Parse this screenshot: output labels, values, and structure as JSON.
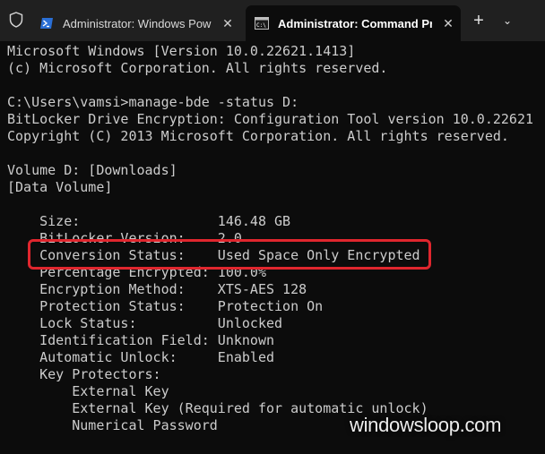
{
  "tabs": [
    {
      "title": "Administrator: Windows Power",
      "icon": "powershell-icon",
      "close": "✕",
      "active": false
    },
    {
      "title": "Administrator: Command Pro",
      "icon": "command-prompt-icon",
      "close": "✕",
      "active": true
    }
  ],
  "tabbar": {
    "new_tab": "+",
    "dropdown": "⌄",
    "shield_icon": "shield-icon"
  },
  "terminal": {
    "lines": [
      "Microsoft Windows [Version 10.0.22621.1413]",
      "(c) Microsoft Corporation. All rights reserved.",
      "",
      "C:\\Users\\vamsi>manage-bde -status D:",
      "BitLocker Drive Encryption: Configuration Tool version 10.0.22621",
      "Copyright (C) 2013 Microsoft Corporation. All rights reserved.",
      "",
      "Volume D: [Downloads]",
      "[Data Volume]",
      "",
      "    Size:                 146.48 GB",
      "    BitLocker Version:    2.0",
      "    Conversion Status:    Used Space Only Encrypted",
      "    Percentage Encrypted: 100.0%",
      "    Encryption Method:    XTS-AES 128",
      "    Protection Status:    Protection On",
      "    Lock Status:          Unlocked",
      "    Identification Field: Unknown",
      "    Automatic Unlock:     Enabled",
      "    Key Protectors:",
      "        External Key",
      "        External Key (Required for automatic unlock)",
      "        Numerical Password"
    ]
  },
  "watermark": "windowsloop.com",
  "colors": {
    "highlight": "#e0262e",
    "background": "#0c0c0c",
    "text": "#cccccc"
  }
}
